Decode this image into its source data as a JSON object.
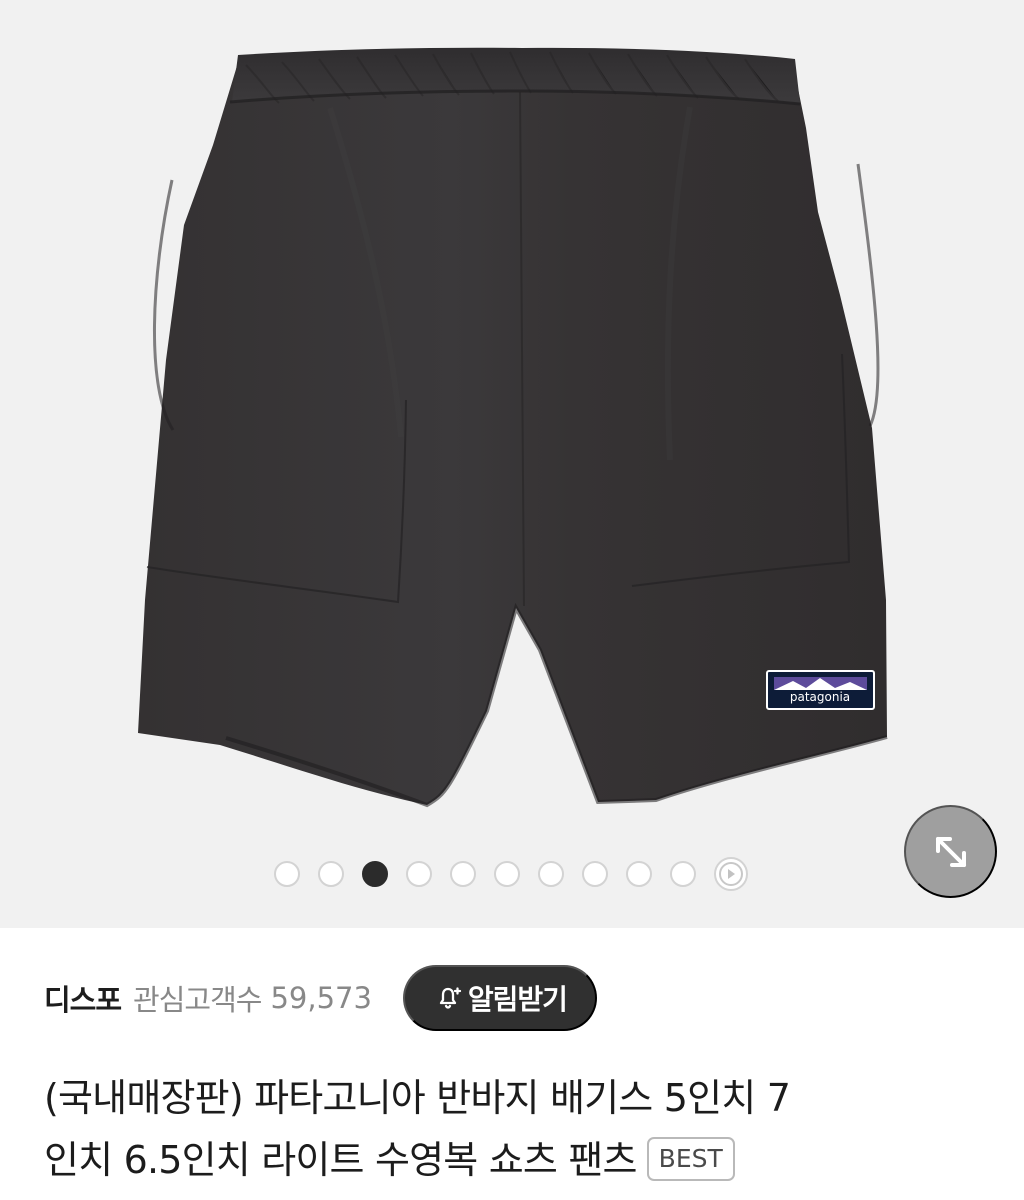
{
  "carousel": {
    "dot_count": 10,
    "active_index": 3,
    "play_icon": "play-circle-icon"
  },
  "controls": {
    "expand_icon": "expand-icon"
  },
  "product": {
    "image_description_icon": "black-shorts-image",
    "brand_logo_text": "patagonia",
    "title_line_1": "(국내매장판) 파타고니아 반바지 배기스 5인치 7",
    "title_line_2": "인치 6.5인치 라이트 수영복 쇼츠 팬츠",
    "badge": "BEST"
  },
  "seller": {
    "name": "디스포",
    "interest_label": "관심고객수",
    "interest_count": "59,573",
    "notify_label": "알림받기",
    "notify_icon": "bell-plus-icon"
  },
  "colors": {
    "background": "#f1f1f1",
    "button_dark": "#303030",
    "muted_text": "#888888"
  }
}
